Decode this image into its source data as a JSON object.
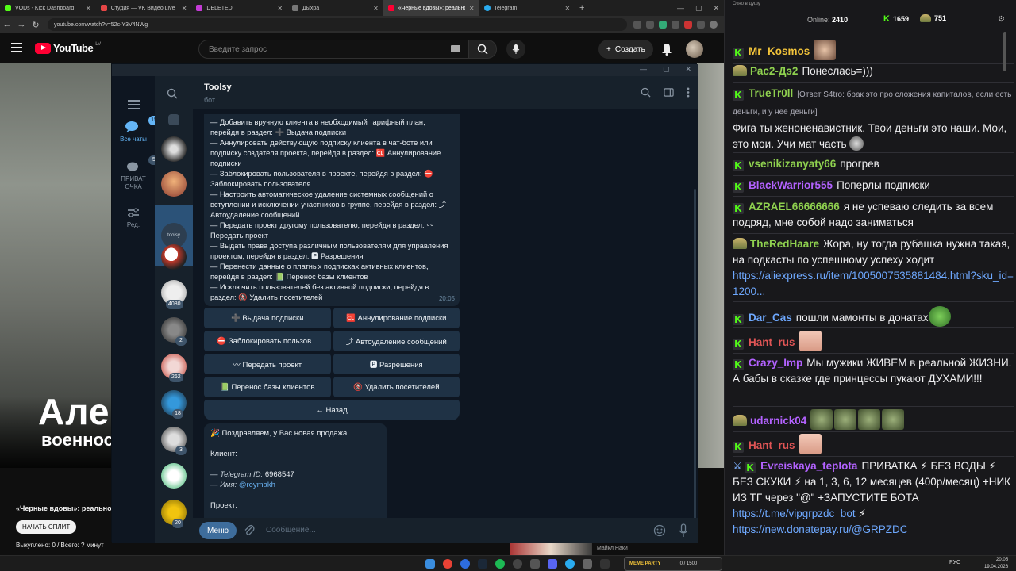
{
  "browser": {
    "tabs": [
      {
        "label": "VODs - Kick Dashboard",
        "color": "#53fc18"
      },
      {
        "label": "Студия — VK Видео Live",
        "color": "#e64646"
      },
      {
        "label": "DELETED",
        "color": "#c43bd6"
      },
      {
        "label": "Дыхра",
        "color": "#777777"
      },
      {
        "label": "«Черные вдовы»: реальность",
        "color": "#ff0033"
      },
      {
        "label": "Telegram",
        "color": "#2aabee"
      }
    ],
    "url": "youtube.com/watch?v=52c-Y3V4NWg"
  },
  "youtube": {
    "logo": "YouTube",
    "region": "LV",
    "search_placeholder": "Введите запрос",
    "create_label": "Создать",
    "video_overlay_title": "Алек",
    "video_overlay_sub": "военнос",
    "video_title": "«Черные вдовы»: реальност",
    "split_button": "НАЧАТЬ СПЛИТ",
    "split_status": "Выкуплено: 0 / Всего: ? минут",
    "related_author": "Майкл Наки"
  },
  "telegram": {
    "folders": [
      {
        "label": "Все чаты",
        "badge": "15",
        "icon": "chat-bubbles-icon"
      },
      {
        "label": "ПРИВАТ ОЧКА",
        "badge": "5",
        "icon": "folder-icon"
      },
      {
        "label": "Ред.",
        "badge": "",
        "icon": "sliders-icon"
      }
    ],
    "chat_badges": [
      "4080",
      "2",
      "262",
      "18",
      "3",
      "20"
    ],
    "chat_name": "Toolsy",
    "chat_status": "бот",
    "message1_lines": [
      "— Добавить вручную клиента в необходимый тарифный план, перейдя в раздел: ➕ Выдача подписки",
      "— Аннулировать действующую подписку клиента в чат-боте или подписку создателя проекта, перейдя в раздел: 🆑 Аннулирование подписки",
      "— Заблокировать пользователя в проекте, перейдя в раздел: ⛔ Заблокировать пользователя",
      "— Настроить автоматическое удаление системных сообщений о вступлении и исключении участников в группе, перейдя в раздел: ⤴ Автоудаление сообщений",
      "— Передать проект другому пользователю, перейдя в раздел: 〰 Передать проект",
      "— Выдать права доступа различным пользователям для управления проектом, перейдя в раздел: 🅿 Разрешения",
      "— Перенести данные о платных подписках активных клиентов, перейдя в раздел: 📗 Перенос базы клиентов",
      "— Исключить пользователей без активной подписки, перейдя в раздел: 🚷 Удалить посетителей"
    ],
    "message1_time": "20:05",
    "keyboard": [
      [
        "➕ Выдача подписки",
        "🆑 Аннулирование подписки"
      ],
      [
        "⛔ Заблокировать пользов...",
        "⤴ Автоудаление сообщений"
      ],
      [
        "〰 Передать проект",
        "🅿 Разрешения"
      ],
      [
        "📗 Перенос базы клиентов",
        "🚷 Удалить посетителей"
      ],
      [
        "← Назад"
      ]
    ],
    "message2": {
      "headline": "🎉 Поздравляем, у Вас новая продажа!",
      "client_label": "Клиент:",
      "tg_id_label": "— Telegram ID:",
      "tg_id_value": "6968547",
      "name_label": "— Имя:",
      "name_value": "@reymakh",
      "project_label": "Проект:"
    },
    "menu_button": "Меню",
    "input_placeholder": "Сообщение..."
  },
  "chat": {
    "window_title": "Окно в душу",
    "online_label": "Online:",
    "online_value": "2410",
    "kick_count": "1659",
    "pepe_count": "751",
    "messages": [
      {
        "badge": "kick",
        "nick": "Mr_Kosmos",
        "color": "#f2c33a",
        "text": ""
      },
      {
        "badge": "pepe",
        "nick": "Рас2-Дэ2",
        "color": "#8fd14f",
        "text": "Понеслась=)))"
      },
      {
        "badge": "kick",
        "nick": "TrueTr0ll",
        "color": "#8fd14f",
        "reply": "[Ответ S4tro: брак это про сложения капиталов, если есть деньги, и у неё деньги]",
        "text": "Фига ты женоненавистник. Твои деньги это наши. Мои, это мои. Учи мат часть"
      },
      {
        "badge": "kick",
        "nick": "vsenikizanyaty66",
        "color": "#8fd14f",
        "text": "прогрев"
      },
      {
        "badge": "kick",
        "nick": "BlackWarrior555",
        "color": "#b362ff",
        "text": "Поперлы подписки"
      },
      {
        "badge": "kick",
        "nick": "AZRAEL66666666",
        "color": "#8fd14f",
        "text": "я не успеваю следить за всем подряд, мне собой надо заниматься"
      },
      {
        "badge": "pepe",
        "nick": "TheRedHaare",
        "color": "#8fd14f",
        "text": "Жора, ну тогда рубашка нужна такая, на подкасты по успешному успеху ходит",
        "link": "https://aliexpress.ru/item/1005007535881484.html?sku_id=1200..."
      },
      {
        "badge": "kick",
        "nick": "Dar_Cas",
        "color": "#6ea8fe",
        "text": "пошли мамонты в донатах"
      },
      {
        "badge": "kick",
        "nick": "Hant_rus",
        "color": "#e05555",
        "text": ""
      },
      {
        "badge": "kick",
        "nick": "Crazy_Imp",
        "color": "#b362ff",
        "text": "Мы мужики ЖИВЕМ в реальной ЖИЗНИ. А бабы в сказке где принцессы пукают ДУХАМИ!!!"
      },
      {
        "badge": "pepe",
        "nick": "udarnick04",
        "color": "#b362ff",
        "text": ""
      },
      {
        "badge": "kick",
        "nick": "Hant_rus",
        "color": "#e05555",
        "text": ""
      },
      {
        "badge": "sword",
        "nick": "Evreiskaya_teplota",
        "color": "#b362ff",
        "text": "ПРИВАТКА ⚡ БЕЗ ВОДЫ ⚡ БЕЗ СКУКИ ⚡ на 1, 3, 6, 12 месяцев (400р/месяц) +НИК ИЗ ТГ через \"@\" +ЗАПУСТИТЕ БОТА",
        "link": "https://t.me/vipgrpzdc_bot",
        "link2": "https://new.donatepay.ru/@GRPZDC"
      }
    ]
  },
  "taskbar": {
    "widget_label": "MEME PARTY",
    "widget_counter": "0 / 1500",
    "lang": "РУС",
    "time": "20:05",
    "date": "19.04.2026"
  }
}
